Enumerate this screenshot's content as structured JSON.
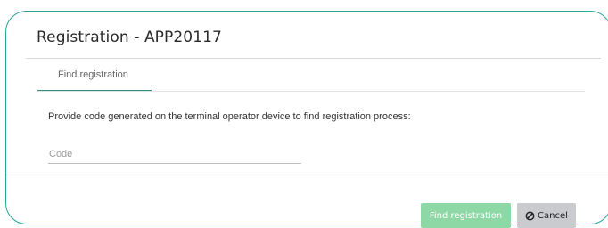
{
  "dialog": {
    "title": "Registration - APP20117"
  },
  "tabs": [
    {
      "label": "Find registration",
      "active": true
    }
  ],
  "form": {
    "instruction": "Provide code generated on the terminal operator device to find registration process:",
    "code_placeholder": "Code",
    "code_value": ""
  },
  "footer": {
    "find_label": "Find registration",
    "cancel_label": "Cancel",
    "cancel_icon": "ban-icon"
  },
  "colors": {
    "dialog_border": "#2aa39a",
    "tab_underline": "#2a8f86",
    "find_button": "#8ed8a6",
    "cancel_button": "#c9cbce"
  }
}
